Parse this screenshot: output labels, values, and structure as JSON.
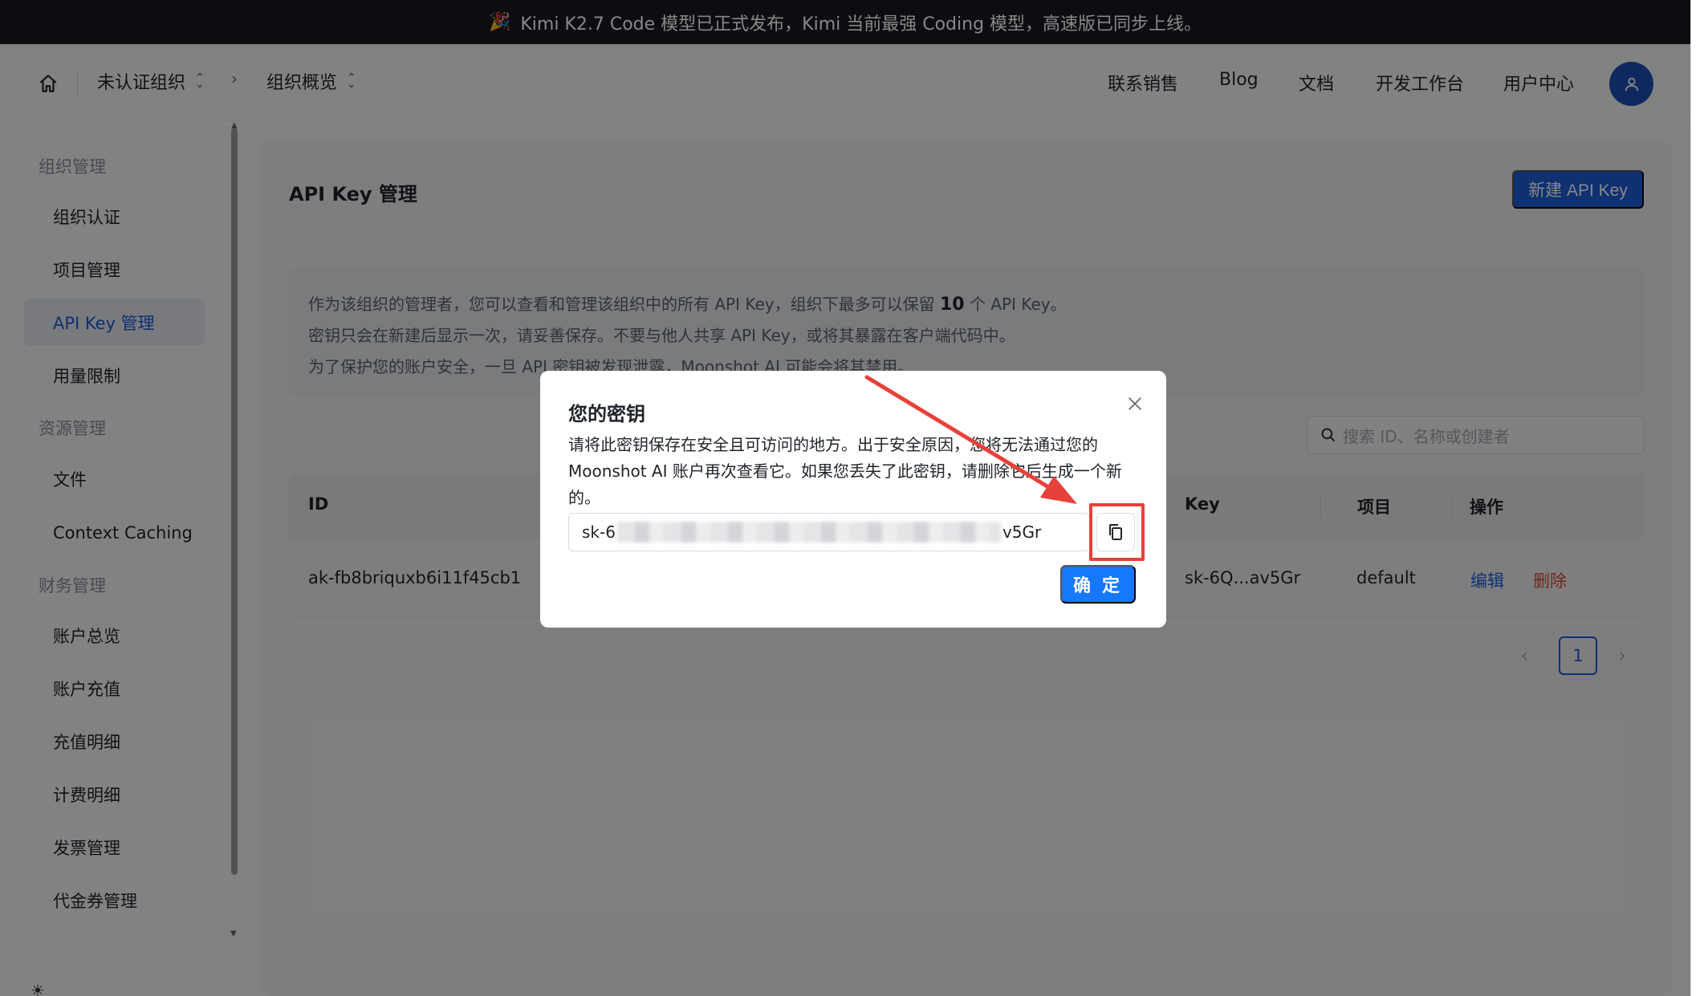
{
  "announcement": {
    "icon": "party-popper-icon",
    "text": "Kimi K2.7 Code 模型已正式发布，Kimi 当前最强 Coding 模型，高速版已同步上线。"
  },
  "header": {
    "org_name": "未认证组织",
    "breadcrumb_page": "组织概览",
    "nav": [
      "联系销售",
      "Blog",
      "文档",
      "开发工作台",
      "用户中心"
    ]
  },
  "sidebar": {
    "groups": [
      {
        "title": "组织管理",
        "items": [
          "组织认证",
          "项目管理",
          "API Key 管理",
          "用量限制"
        ]
      },
      {
        "title": "资源管理",
        "items": [
          "文件",
          "Context Caching"
        ]
      },
      {
        "title": "财务管理",
        "items": [
          "账户总览",
          "账户充值",
          "充值明细",
          "计费明细",
          "发票管理",
          "代金券管理"
        ]
      }
    ],
    "active": "API Key 管理"
  },
  "main": {
    "title": "API Key 管理",
    "new_button": "新建 API Key",
    "info_line1_pre": "作为该组织的管理者，您可以查看和管理该组织中的所有 API Key，组织下最多可以保留",
    "info_line1_num": "10",
    "info_line1_post": "个 API Key。",
    "info_line2": "密钥只会在新建后显示一次，请妥善保存。不要与他人共享 API Key，或将其暴露在客户端代码中。",
    "info_line3": "为了保护您的账户安全，一旦 API 密钥被发现泄露，Moonshot AI 可能会将其禁用。",
    "search_placeholder": "搜索 ID、名称或创建者",
    "table": {
      "columns": [
        "ID",
        "Key",
        "项目",
        "操作"
      ],
      "rows": [
        {
          "id": "ak-fb8briquxb6i11f45cb1",
          "key": "sk-6Q...av5Gr",
          "project": "default",
          "edit": "编辑",
          "delete": "删除"
        }
      ]
    },
    "pagination": {
      "current": "1"
    }
  },
  "modal": {
    "title": "您的密钥",
    "body": "请将此密钥保存在安全且可访问的地方。出于安全原因，您将无法通过您的 Moonshot AI 账户再次查看它。如果您丢失了此密钥，请删除它后生成一个新的。",
    "key_prefix": "sk-6",
    "key_suffix": "v5Gr",
    "ok_button": "确 定"
  },
  "colors": {
    "primary": "#1e5bd6",
    "ok_button": "#1677ff",
    "danger": "#e0463b",
    "annotation_red": "#e8413a"
  }
}
